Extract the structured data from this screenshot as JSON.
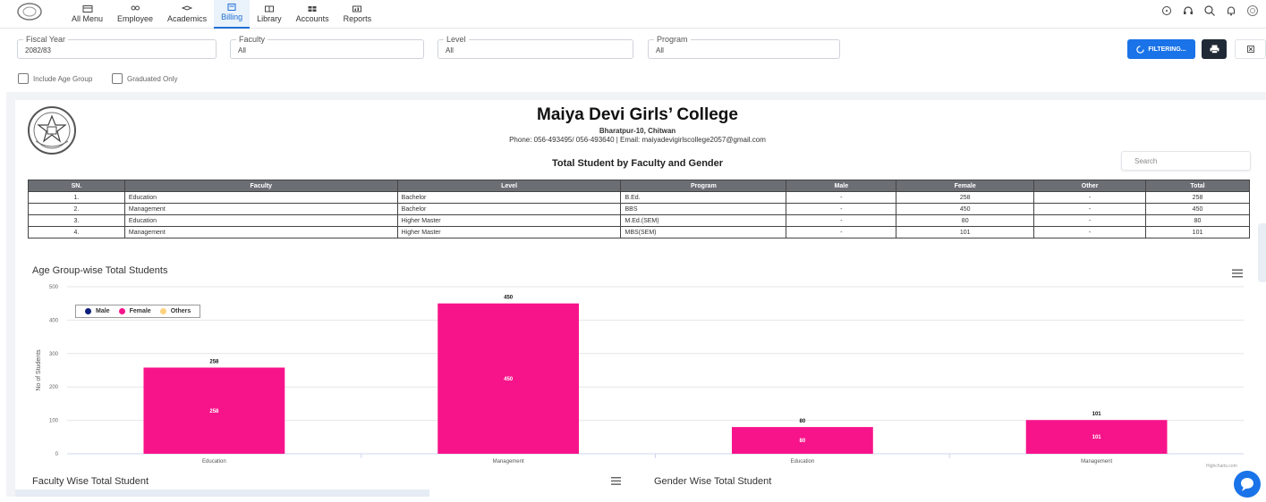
{
  "nav": {
    "items": [
      {
        "label": "All Menu",
        "icon": "grid-icon"
      },
      {
        "label": "Employee",
        "icon": "users-icon"
      },
      {
        "label": "Academics",
        "icon": "graduation-cap-icon"
      },
      {
        "label": "Billing",
        "icon": "billing-icon",
        "active": true
      },
      {
        "label": "Library",
        "icon": "book-icon"
      },
      {
        "label": "Accounts",
        "icon": "accounts-icon"
      },
      {
        "label": "Reports",
        "icon": "report-icon"
      }
    ],
    "right_icons": [
      "sync-icon",
      "headset-icon",
      "search-icon",
      "bell-icon",
      "logo-icon"
    ]
  },
  "filters": {
    "fiscal_year": {
      "label": "Fiscal Year",
      "value": "2082/83"
    },
    "faculty": {
      "label": "Faculty",
      "value": "All"
    },
    "level": {
      "label": "Level",
      "value": "All"
    },
    "program": {
      "label": "Program",
      "value": "All"
    },
    "filter_button": "FILTERING...",
    "include_age_group": "Include Age Group",
    "graduated_only": "Graduated Only"
  },
  "report": {
    "college_name": "Maiya Devi Girls’ College",
    "address": "Bharatpur-10, Chitwan",
    "contact": "Phone: 056-493495/ 056-493640 | Email: maiyadevigirlscollege2057@gmail.com",
    "title": "Total Student by Faculty and Gender",
    "search_placeholder": "Search",
    "columns": [
      "SN.",
      "Faculty",
      "Level",
      "Program",
      "Male",
      "Female",
      "Other",
      "Total"
    ],
    "rows": [
      [
        "1.",
        "Education",
        "Bachelor",
        "B.Ed.",
        "-",
        "258",
        "-",
        "258"
      ],
      [
        "2.",
        "Management",
        "Bachelor",
        "BBS",
        "-",
        "450",
        "-",
        "450"
      ],
      [
        "3.",
        "Education",
        "Higher Master",
        "M.Ed.(SEM)",
        "-",
        "80",
        "-",
        "80"
      ],
      [
        "4.",
        "Management",
        "Higher Master",
        "MBS(SEM)",
        "-",
        "101",
        "-",
        "101"
      ]
    ]
  },
  "chart_data": {
    "type": "bar",
    "title": "Age Group-wise Total Students",
    "ylabel": "No of Students",
    "xlabel": "",
    "categories": [
      "Education",
      "Management",
      "Education",
      "Management"
    ],
    "series": [
      {
        "name": "Male",
        "values": [
          0,
          0,
          0,
          0
        ],
        "color": "#0b1f7a"
      },
      {
        "name": "Female",
        "values": [
          258,
          450,
          80,
          101
        ],
        "color": "#f7148b"
      },
      {
        "name": "Others",
        "values": [
          0,
          0,
          0,
          0
        ],
        "color": "#ffd27f"
      }
    ],
    "yticks": [
      0,
      100,
      200,
      300,
      400,
      500
    ],
    "ylim": [
      0,
      500
    ],
    "legend_position": "top-left",
    "grid": true,
    "credits": "Highcharts.com"
  },
  "bottom": {
    "left_title": "Faculty Wise Total Student",
    "right_title": "Gender Wise Total Student"
  }
}
